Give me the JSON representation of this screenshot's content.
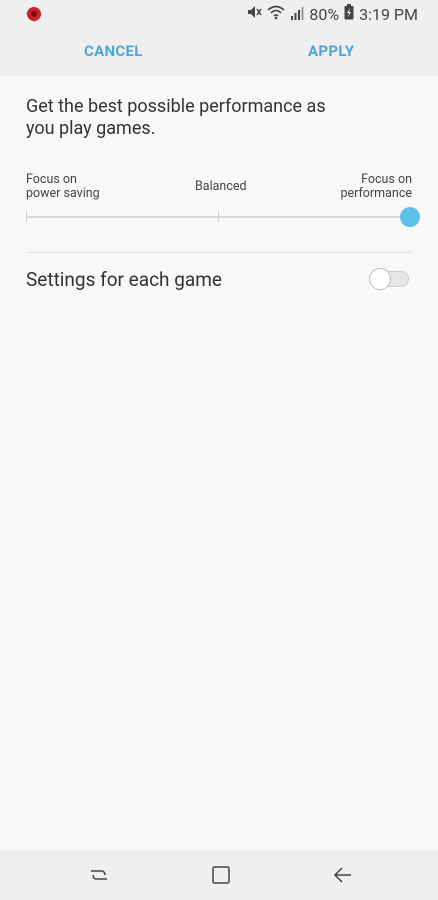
{
  "status_bar": {
    "battery_percent": "80%",
    "time": "3:19 PM",
    "icons": [
      "game-launcher-icon",
      "mute-icon",
      "wifi-icon",
      "signal-icon",
      "battery-charging-icon"
    ]
  },
  "header": {
    "cancel_label": "CANCEL",
    "apply_label": "APPLY",
    "accent_color": "#4aa8d6"
  },
  "description": "Get the best possible performance as you play games.",
  "slider": {
    "left_label": "Focus on power saving",
    "left_label_line1": "Focus on",
    "left_label_line2": "power saving",
    "middle_label": "Balanced",
    "right_label_line1": "Focus on",
    "right_label_line2": "performance",
    "value_fraction": 1.0,
    "thumb_color": "#5cc0ea"
  },
  "settings": {
    "per_game_label": "Settings for each game",
    "per_game_enabled": false
  },
  "nav_bar": {
    "icons": [
      "recent-apps-icon",
      "home-icon",
      "back-icon"
    ]
  }
}
